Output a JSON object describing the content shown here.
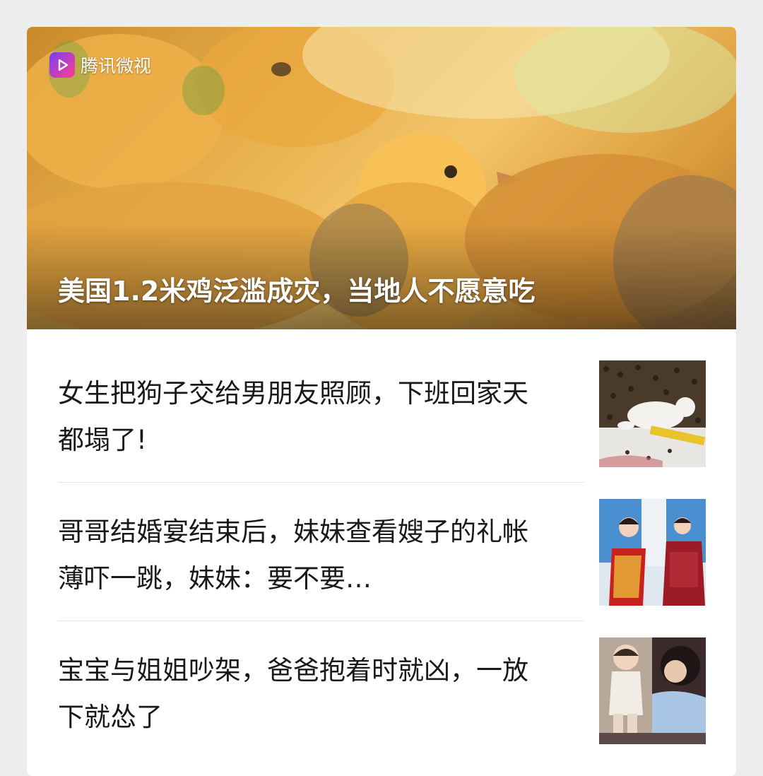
{
  "hero": {
    "source_label": "腾讯微视",
    "title": "美国1.2米鸡泛滥成灾，当地人不愿意吃"
  },
  "articles": [
    {
      "title": "女生把狗子交给男朋友照顾，下班回家天都塌了!"
    },
    {
      "title": "哥哥结婚宴结束后，妹妹查看嫂子的礼帐薄吓一跳，妹妹：要不要…"
    },
    {
      "title": "宝宝与姐姐吵架，爸爸抱着时就凶，一放下就怂了"
    }
  ],
  "colors": {
    "page_bg": "#ededed",
    "card_bg": "#ffffff",
    "text": "#191919",
    "divider": "#e5e5e5"
  }
}
